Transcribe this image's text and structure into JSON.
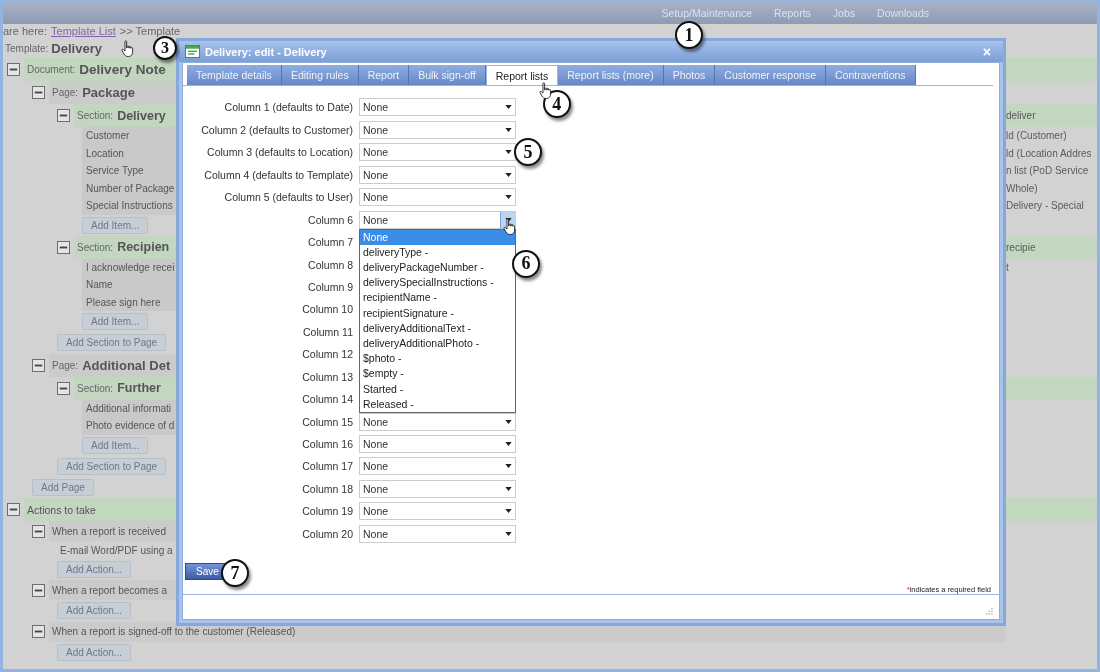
{
  "top_nav": {
    "items": [
      {
        "label": "Setup/Maintenance"
      },
      {
        "label": "Reports"
      },
      {
        "label": "Jobs"
      },
      {
        "label": "Downloads"
      }
    ],
    "callout": "1"
  },
  "breadcrumb": {
    "prefix": "are here:",
    "link": "Template List",
    "suffix": ">> Template"
  },
  "tree": {
    "prefix": "Template:",
    "name": "Delivery",
    "callout": "3",
    "nodes": [
      {
        "kind": "document",
        "prefix": "Document:",
        "name": "Delivery Note",
        "expanded": true,
        "children": [
          {
            "kind": "page",
            "prefix": "Page:",
            "name": "Package",
            "expanded": true,
            "children": [
              {
                "kind": "section",
                "prefix": "Section:",
                "name": "Delivery",
                "right": "deliver",
                "expanded": true,
                "children": [
                  {
                    "kind": "field",
                    "label": "Customer",
                    "right": "ld (Customer)"
                  },
                  {
                    "kind": "field",
                    "label": "Location",
                    "right": "ld (Location Addres"
                  },
                  {
                    "kind": "field",
                    "label": "Service Type",
                    "right": "n list (PoD Service"
                  },
                  {
                    "kind": "field",
                    "label": "Number of Package",
                    "right": "Whole)"
                  },
                  {
                    "kind": "field",
                    "label": "Special Instructions",
                    "right": "Delivery - Special"
                  },
                  {
                    "kind": "button",
                    "label": "Add Item..."
                  }
                ]
              },
              {
                "kind": "section",
                "prefix": "Section:",
                "name": "Recipien",
                "right": "recipie",
                "expanded": true,
                "children": [
                  {
                    "kind": "field",
                    "label": "I acknowledge recei",
                    "right": "t"
                  },
                  {
                    "kind": "field",
                    "label": "Name"
                  },
                  {
                    "kind": "field",
                    "label": "Please sign here"
                  },
                  {
                    "kind": "button",
                    "label": "Add Item..."
                  }
                ]
              },
              {
                "kind": "button",
                "label": "Add Section to Page"
              }
            ]
          },
          {
            "kind": "page",
            "prefix": "Page:",
            "name": "Additional Det",
            "expanded": true,
            "children": [
              {
                "kind": "section",
                "prefix": "Section:",
                "name": "Further",
                "expanded": true,
                "children": [
                  {
                    "kind": "field",
                    "label": "Additional informati"
                  },
                  {
                    "kind": "field",
                    "label": "Photo evidence of d"
                  },
                  {
                    "kind": "button",
                    "label": "Add Item..."
                  }
                ]
              },
              {
                "kind": "button",
                "label": "Add Section to Page"
              }
            ]
          },
          {
            "kind": "button",
            "label": "Add Page"
          }
        ]
      },
      {
        "kind": "actions",
        "label": "Actions to take",
        "expanded": true,
        "children": [
          {
            "kind": "trigger",
            "label": "When a report is received",
            "expanded": true,
            "children": [
              {
                "kind": "action",
                "label": "E-mail Word/PDF using a"
              },
              {
                "kind": "button",
                "label": "Add Action..."
              }
            ]
          },
          {
            "kind": "trigger",
            "label": "When a report becomes a",
            "expanded": true,
            "children": [
              {
                "kind": "button",
                "label": "Add Action..."
              }
            ]
          },
          {
            "kind": "trigger",
            "label": "When a report is signed-off to the customer (Released)",
            "expanded": true,
            "children": [
              {
                "kind": "button",
                "label": "Add Action..."
              }
            ]
          }
        ]
      }
    ]
  },
  "dialog": {
    "title": "Delivery: edit - Delivery",
    "close": "×",
    "tabs": [
      {
        "label": "Template details",
        "selected": false
      },
      {
        "label": "Editing rules",
        "selected": false
      },
      {
        "label": "Report",
        "selected": false
      },
      {
        "label": "Bulk sign-off",
        "selected": false
      },
      {
        "label": "Report lists",
        "selected": true,
        "callout": "4"
      },
      {
        "label": "Report lists (more)",
        "selected": false
      },
      {
        "label": "Photos",
        "selected": false
      },
      {
        "label": "Customer response",
        "selected": false
      },
      {
        "label": "Contraventions",
        "selected": false
      }
    ],
    "columns": [
      {
        "label": "Column 1 (defaults to Date)",
        "value": "None"
      },
      {
        "label": "Column 2 (defaults to Customer)",
        "value": "None"
      },
      {
        "label": "Column 3 (defaults to Location)",
        "value": "None",
        "callout": "5"
      },
      {
        "label": "Column 4 (defaults to Template)",
        "value": "None"
      },
      {
        "label": "Column 5 (defaults to User)",
        "value": "None"
      },
      {
        "label": "Column 6",
        "value": "None",
        "open": true,
        "callout": "6",
        "options": [
          {
            "label": "None",
            "selected": true
          },
          {
            "label": "deliveryType -",
            "selected": false
          },
          {
            "label": "deliveryPackageNumber -",
            "selected": false
          },
          {
            "label": "deliverySpecialInstructions -",
            "selected": false
          },
          {
            "label": "recipientName -",
            "selected": false
          },
          {
            "label": "recipientSignature -",
            "selected": false
          },
          {
            "label": "deliveryAdditionalText -",
            "selected": false
          },
          {
            "label": "deliveryAdditionalPhoto -",
            "selected": false
          },
          {
            "label": "$photo -",
            "selected": false
          },
          {
            "label": "$empty -",
            "selected": false
          },
          {
            "label": "Started -",
            "selected": false
          },
          {
            "label": "Released -",
            "selected": false
          }
        ]
      },
      {
        "label": "Column 7"
      },
      {
        "label": "Column 8"
      },
      {
        "label": "Column 9"
      },
      {
        "label": "Column 10"
      },
      {
        "label": "Column 11"
      },
      {
        "label": "Column 12"
      },
      {
        "label": "Column 13"
      },
      {
        "label": "Column 14"
      },
      {
        "label": "Column 15",
        "value": "None"
      },
      {
        "label": "Column 16",
        "value": "None"
      },
      {
        "label": "Column 17",
        "value": "None"
      },
      {
        "label": "Column 18",
        "value": "None"
      },
      {
        "label": "Column 19",
        "value": "None"
      },
      {
        "label": "Column 20",
        "value": "None"
      }
    ],
    "save": {
      "label": "Save",
      "callout": "7"
    },
    "required_mark": "*",
    "required_note": "indicates a required field"
  }
}
